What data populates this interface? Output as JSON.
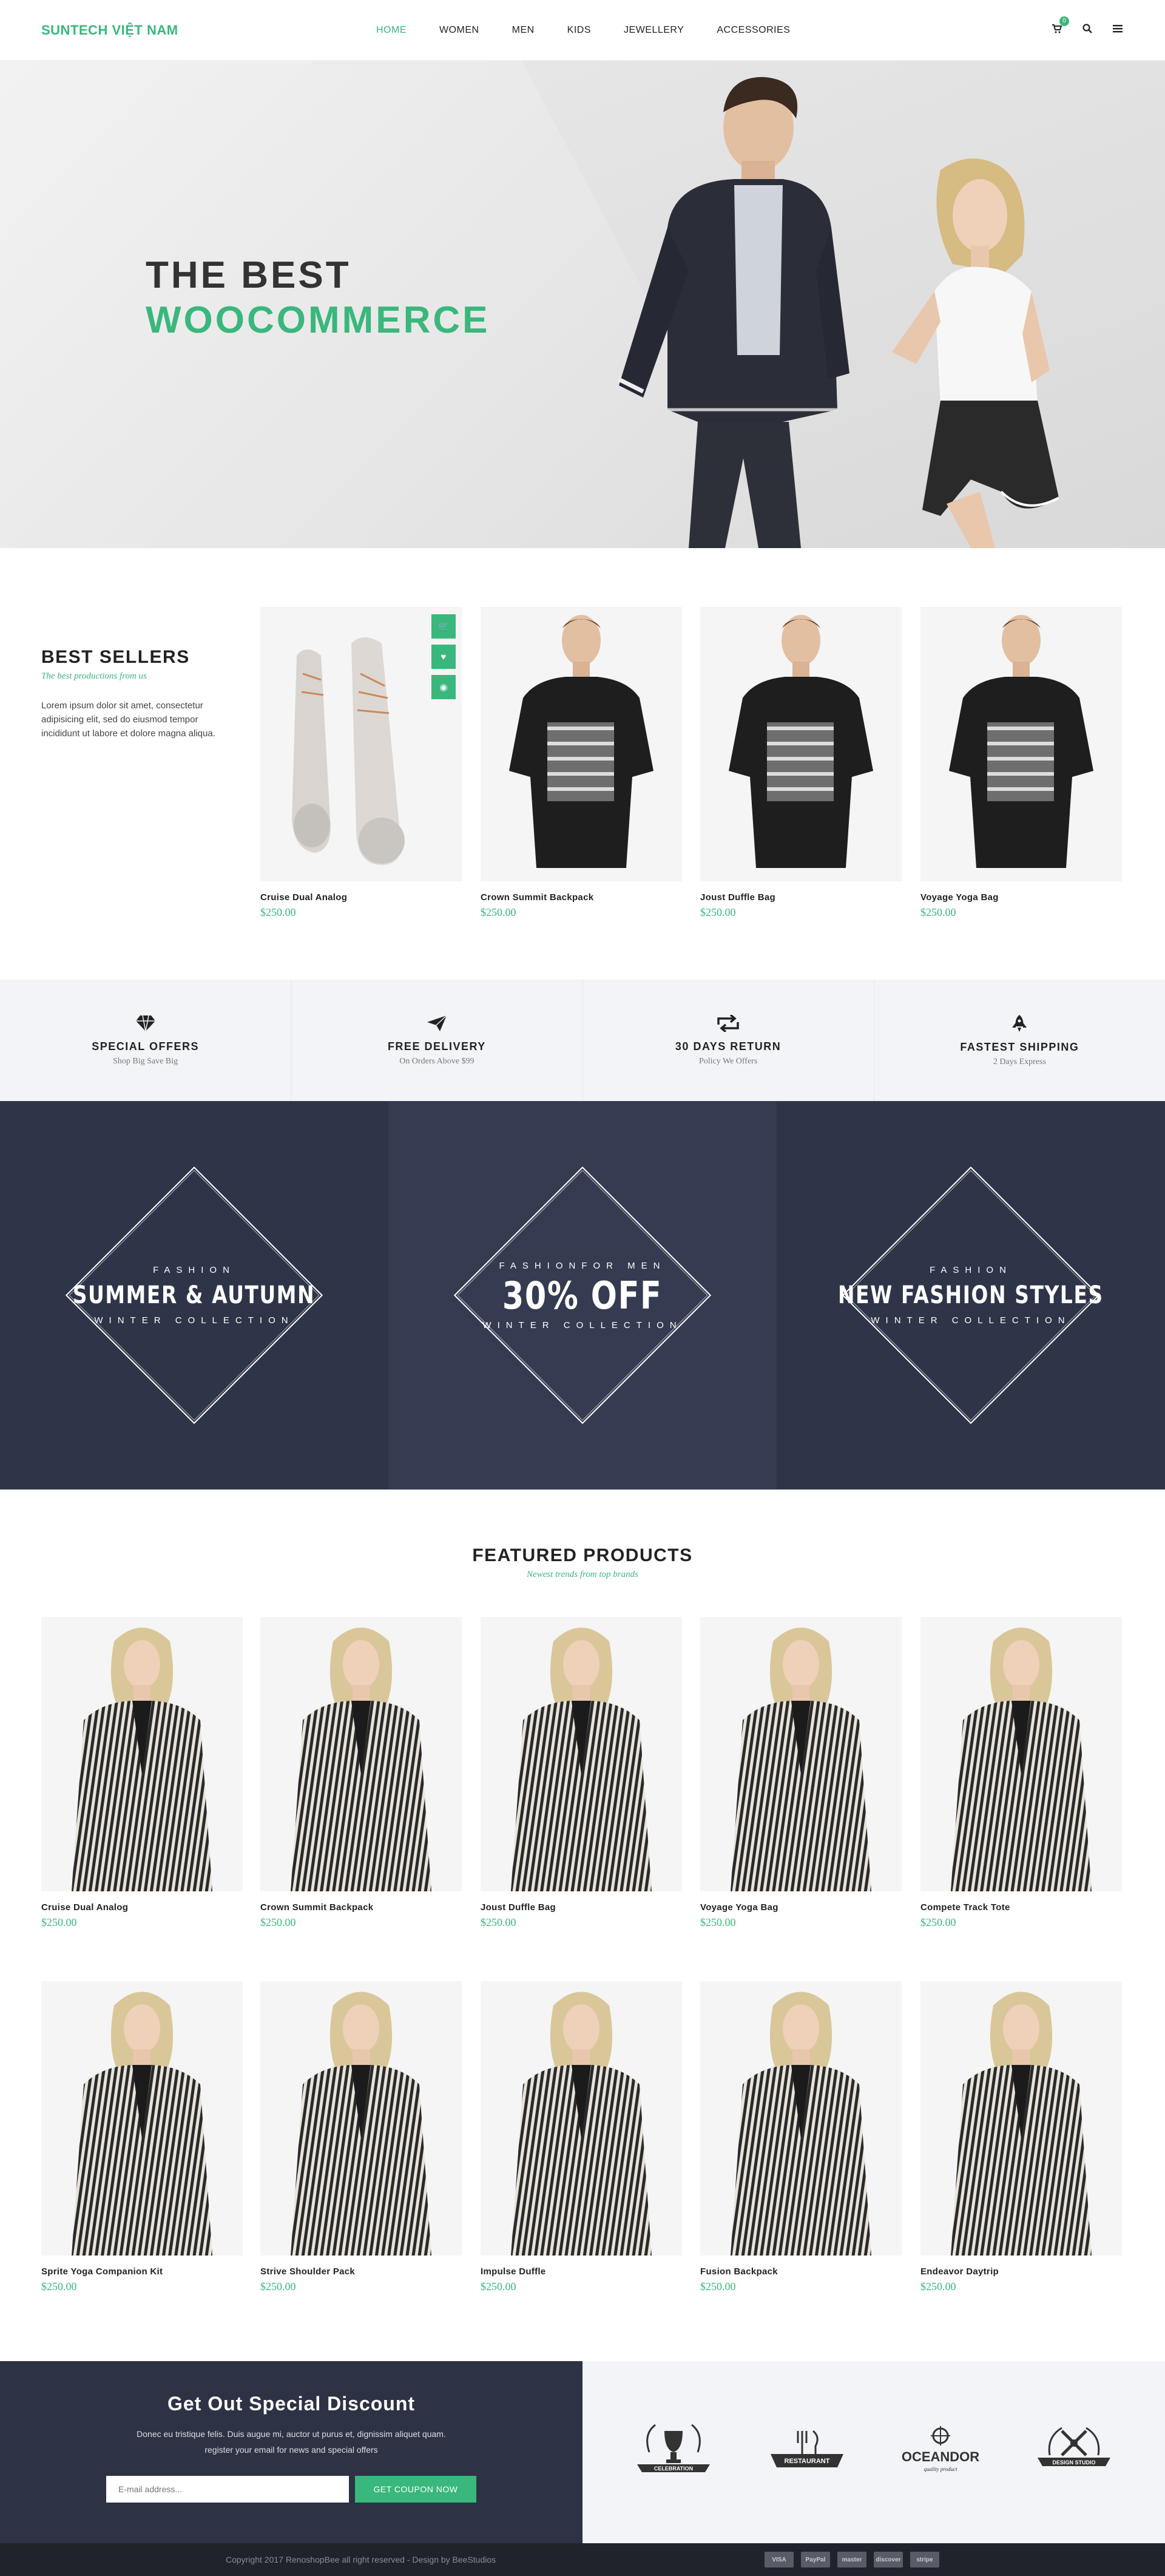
{
  "header": {
    "logo": "SUNTECH VIỆT NAM",
    "nav": [
      "HOME",
      "WOMEN",
      "MEN",
      "KIDS",
      "JEWELLERY",
      "ACCESSORIES"
    ],
    "active_nav": "HOME",
    "cart_count": "0",
    "accent": "#3ab77c"
  },
  "hero": {
    "line1": "THE BEST",
    "line2": "WOOCOMMERCE"
  },
  "best_sellers": {
    "title": "BEST SELLERS",
    "subtitle": "The best productions from us",
    "description": "Lorem ipsum dolor sit amet, consectetur adipisicing elit, sed do eiusmod tempor incididunt ut labore et dolore magna aliqua.",
    "products": [
      {
        "name": "Cruise Dual Analog",
        "price": "$250.00"
      },
      {
        "name": "Crown Summit Backpack",
        "price": "$250.00"
      },
      {
        "name": "Joust Duffle Bag",
        "price": "$250.00"
      },
      {
        "name": "Voyage Yoga Bag",
        "price": "$250.00"
      }
    ]
  },
  "features": [
    {
      "icon": "diamond-icon",
      "title": "SPECIAL OFFERS",
      "sub": "Shop Big Save Big"
    },
    {
      "icon": "paper-plane-icon",
      "title": "FREE DELIVERY",
      "sub": "On Orders Above $99"
    },
    {
      "icon": "return-icon",
      "title": "30 DAYS RETURN",
      "sub": "Policy We Offers"
    },
    {
      "icon": "rocket-icon",
      "title": "FASTEST SHIPPING",
      "sub": "2 Days Express"
    }
  ],
  "banners": [
    {
      "top": "FASHION",
      "main": "SUMMER & AUTUMN",
      "bottom": "WINTER COLLECTION",
      "bg": "#2f3548"
    },
    {
      "top": "FASHIONFOR MEN",
      "main": "30% OFF",
      "bottom": "WINTER COLLECTION",
      "bg": "#353b50"
    },
    {
      "top": "FASHION",
      "main": "NEW FASHION STYLES",
      "bottom": "WINTER COLLECTION",
      "bg": "#2f3548"
    }
  ],
  "featured": {
    "title": "FEATURED PRODUCTS",
    "subtitle": "Newest trends from top brands",
    "products": [
      {
        "name": "Cruise Dual Analog",
        "price": "$250.00"
      },
      {
        "name": "Crown Summit Backpack",
        "price": "$250.00"
      },
      {
        "name": "Joust Duffle Bag",
        "price": "$250.00"
      },
      {
        "name": "Voyage Yoga Bag",
        "price": "$250.00"
      },
      {
        "name": "Compete Track Tote",
        "price": "$250.00"
      },
      {
        "name": "Sprite Yoga Companion Kit",
        "price": "$250.00"
      },
      {
        "name": "Strive Shoulder Pack",
        "price": "$250.00"
      },
      {
        "name": "Impulse Duffle",
        "price": "$250.00"
      },
      {
        "name": "Fusion Backpack",
        "price": "$250.00"
      },
      {
        "name": "Endeavor Daytrip",
        "price": "$250.00"
      }
    ]
  },
  "discount": {
    "title": "Get Out Special Discount",
    "text1": "Donec eu tristique felis. Duis augue mi, auctor ut purus et, dignissim aliquet quam.",
    "text2": "register your email for news and special offers",
    "placeholder": "E-mail address...",
    "button": "GET COUPON NOW"
  },
  "brands": [
    "CELEBRATION",
    "RESTAURANT",
    "OCEANDOR",
    "DESIGN STUDIO"
  ],
  "brand_sub": {
    "oceandor": "quality product"
  },
  "footer": {
    "copyright": "Copyright 2017 RenoshopBee all right reserved  -  Design by BeeStudios",
    "payments": [
      "VISA",
      "PayPal",
      "master",
      "discover",
      "stripe"
    ]
  }
}
